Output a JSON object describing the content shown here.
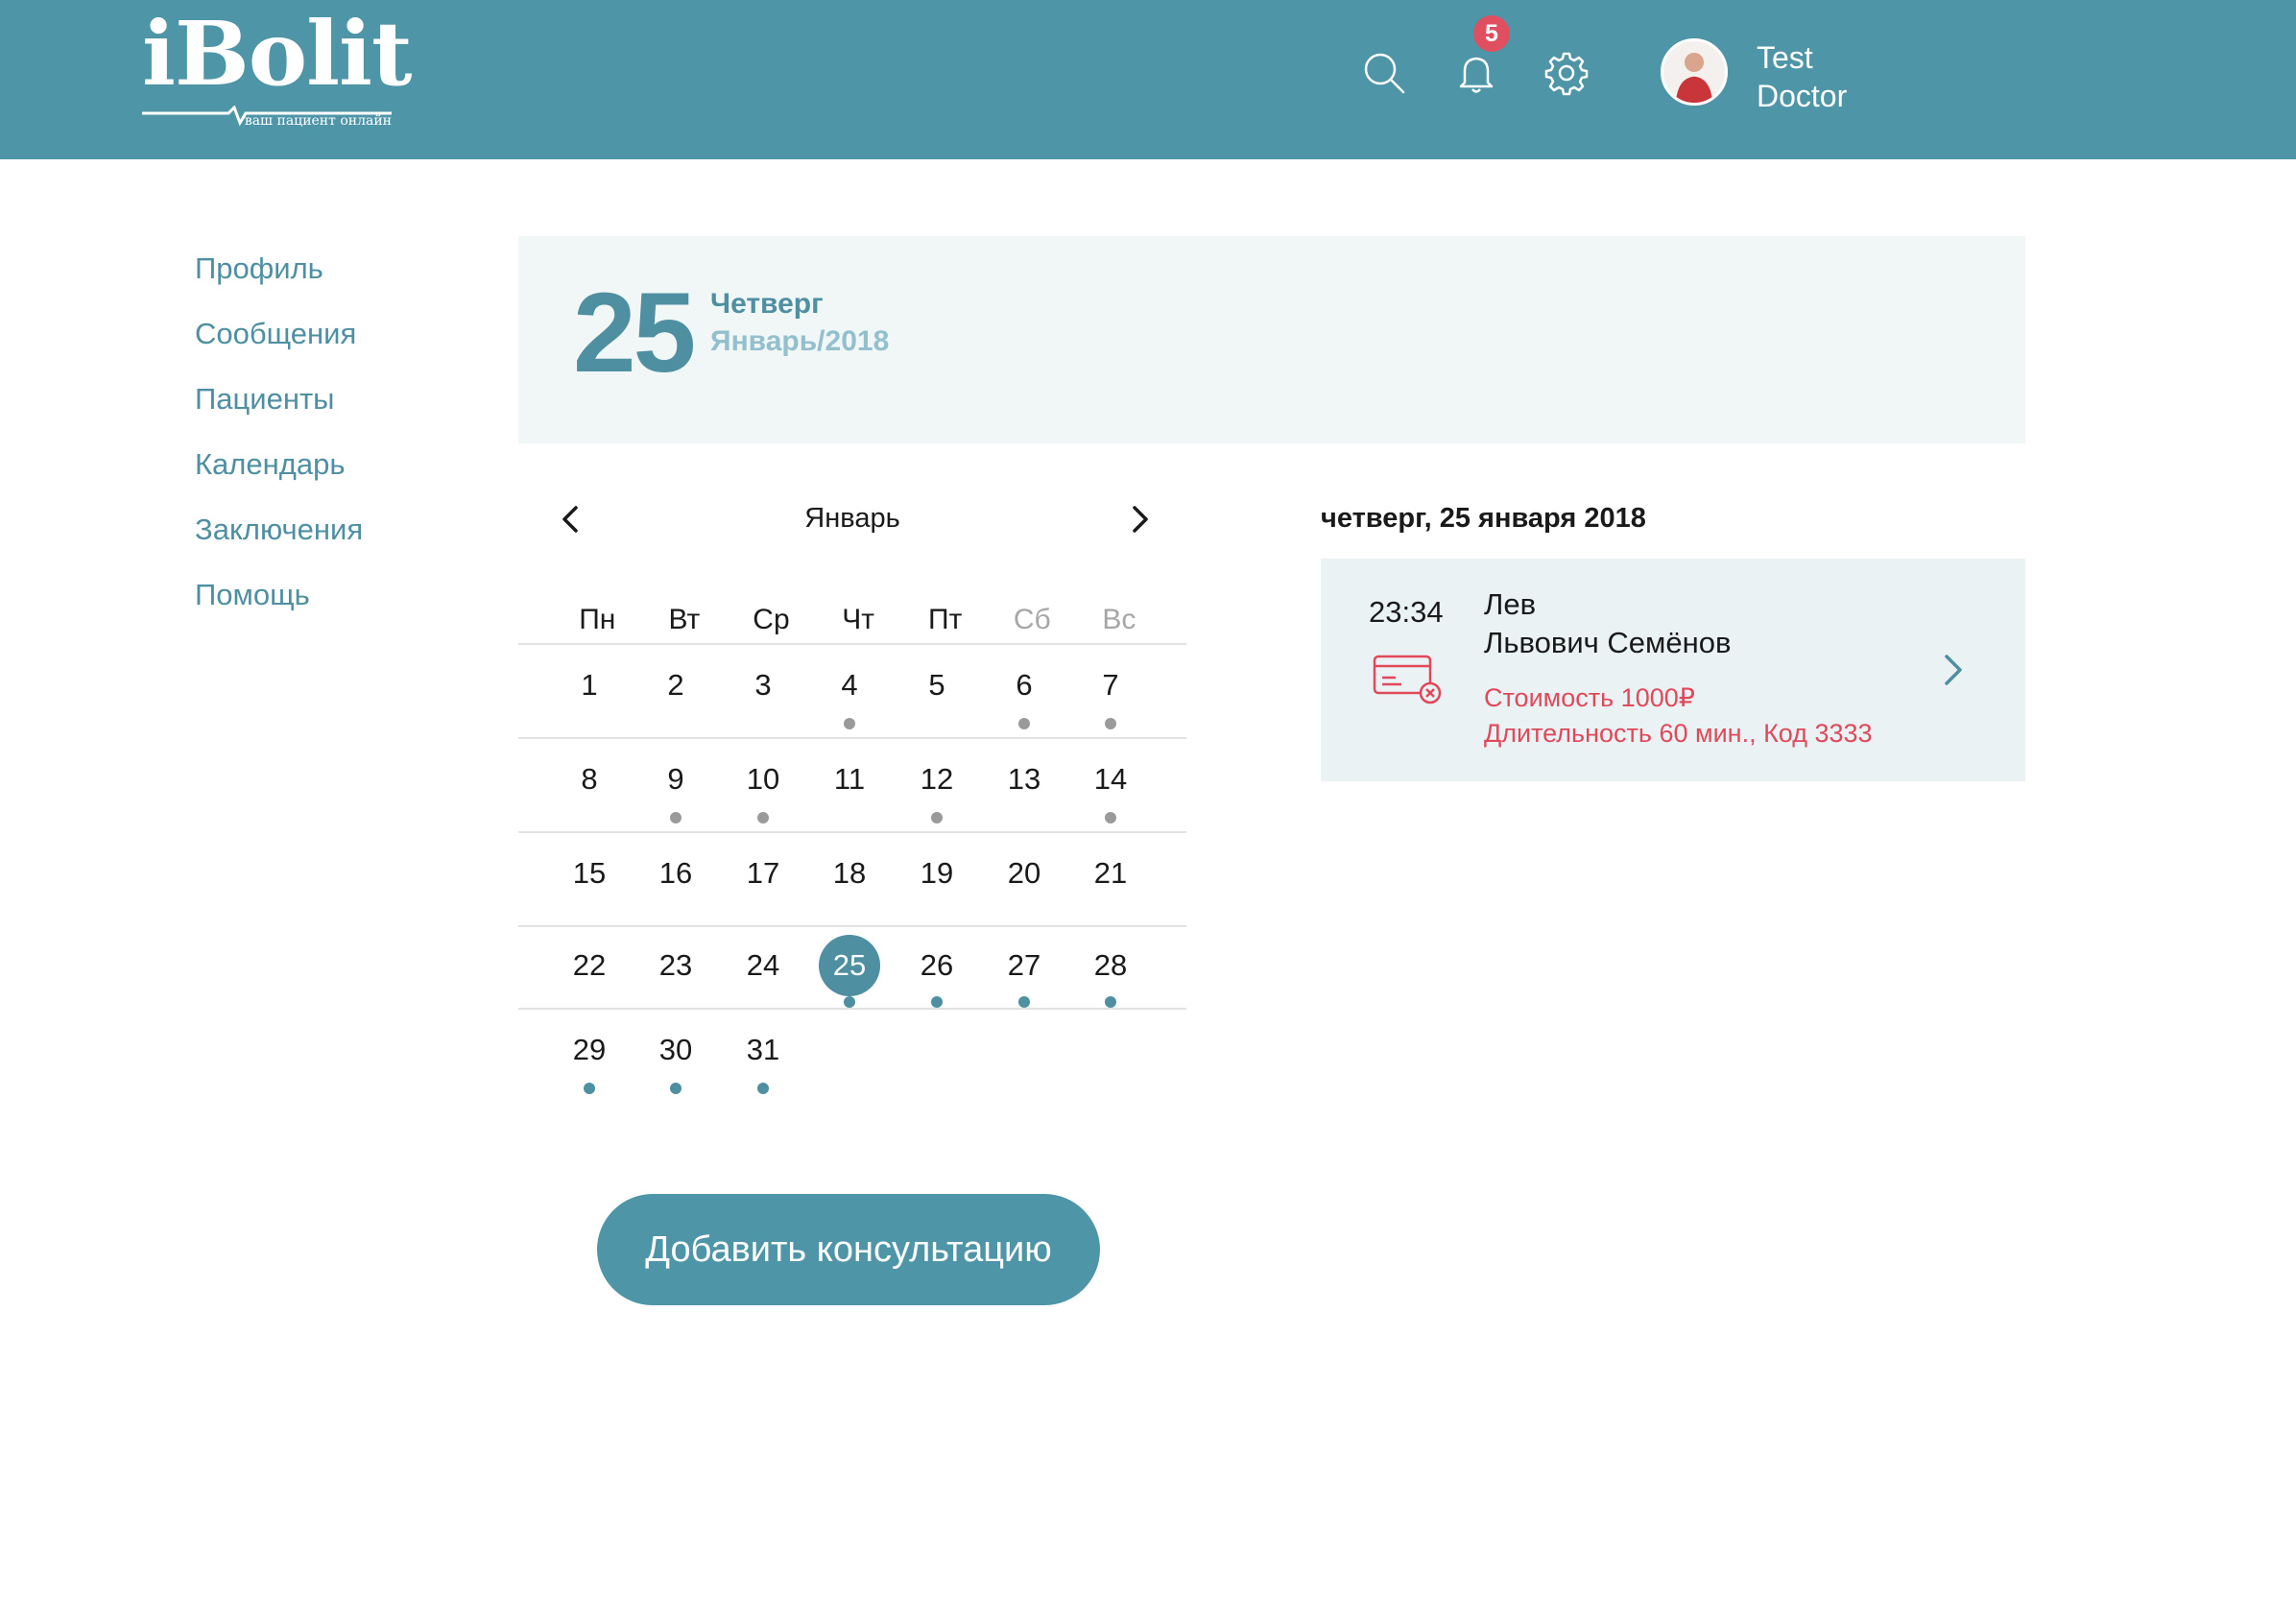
{
  "header": {
    "logo_text": "iBolit",
    "logo_tagline": "ваш пациент онлайн",
    "notifications_count": "5",
    "user_name_first": "Test",
    "user_name_last": "Doctor",
    "icons": [
      "search-icon",
      "bell-icon",
      "gear-icon"
    ]
  },
  "sidebar": {
    "items": [
      {
        "label": "Профиль"
      },
      {
        "label": "Сообщения"
      },
      {
        "label": "Пациенты"
      },
      {
        "label": "Календарь"
      },
      {
        "label": "Заключения"
      },
      {
        "label": "Помощь"
      }
    ]
  },
  "banner": {
    "day": "25",
    "weekday": "Четверг",
    "month_year": "Январь/2018"
  },
  "calendar": {
    "month": "Январь",
    "weekdays": [
      "Пн",
      "Вт",
      "Ср",
      "Чт",
      "Пт",
      "Сб",
      "Вс"
    ],
    "weeks": [
      [
        {
          "d": "1",
          "dot": ""
        },
        {
          "d": "2",
          "dot": ""
        },
        {
          "d": "3",
          "dot": ""
        },
        {
          "d": "4",
          "dot": "grey"
        },
        {
          "d": "5",
          "dot": ""
        },
        {
          "d": "6",
          "dot": "grey"
        },
        {
          "d": "7",
          "dot": "grey"
        }
      ],
      [
        {
          "d": "8",
          "dot": ""
        },
        {
          "d": "9",
          "dot": "grey"
        },
        {
          "d": "10",
          "dot": "grey"
        },
        {
          "d": "11",
          "dot": ""
        },
        {
          "d": "12",
          "dot": "grey"
        },
        {
          "d": "13",
          "dot": ""
        },
        {
          "d": "14",
          "dot": "grey"
        }
      ],
      [
        {
          "d": "15",
          "dot": ""
        },
        {
          "d": "16",
          "dot": ""
        },
        {
          "d": "17",
          "dot": ""
        },
        {
          "d": "18",
          "dot": ""
        },
        {
          "d": "19",
          "dot": ""
        },
        {
          "d": "20",
          "dot": ""
        },
        {
          "d": "21",
          "dot": ""
        }
      ],
      [
        {
          "d": "22",
          "dot": ""
        },
        {
          "d": "23",
          "dot": ""
        },
        {
          "d": "24",
          "dot": ""
        },
        {
          "d": "25",
          "dot": "teal",
          "selected": true
        },
        {
          "d": "26",
          "dot": "teal"
        },
        {
          "d": "27",
          "dot": "teal"
        },
        {
          "d": "28",
          "dot": "teal"
        }
      ],
      [
        {
          "d": "29",
          "dot": "teal"
        },
        {
          "d": "30",
          "dot": "teal"
        },
        {
          "d": "31",
          "dot": "teal"
        }
      ]
    ]
  },
  "appointments": {
    "date_heading": "четверг, 25 января 2018",
    "items": [
      {
        "time": "23:34",
        "name_first": "Лев",
        "name_rest": "Львович Семёнов",
        "cost": "Стоимость 1000₽",
        "duration_code": "Длительность 60 мин., Код 3333"
      }
    ]
  },
  "actions": {
    "add_consultation": "Добавить консультацию"
  },
  "colors": {
    "header_bg": "#4e95a8",
    "accent": "#4e8fa2",
    "badge": "#e04f5f",
    "alert_text": "#e0495a",
    "banner_bg": "#f1f6f7",
    "card_bg": "#eaf2f4"
  }
}
